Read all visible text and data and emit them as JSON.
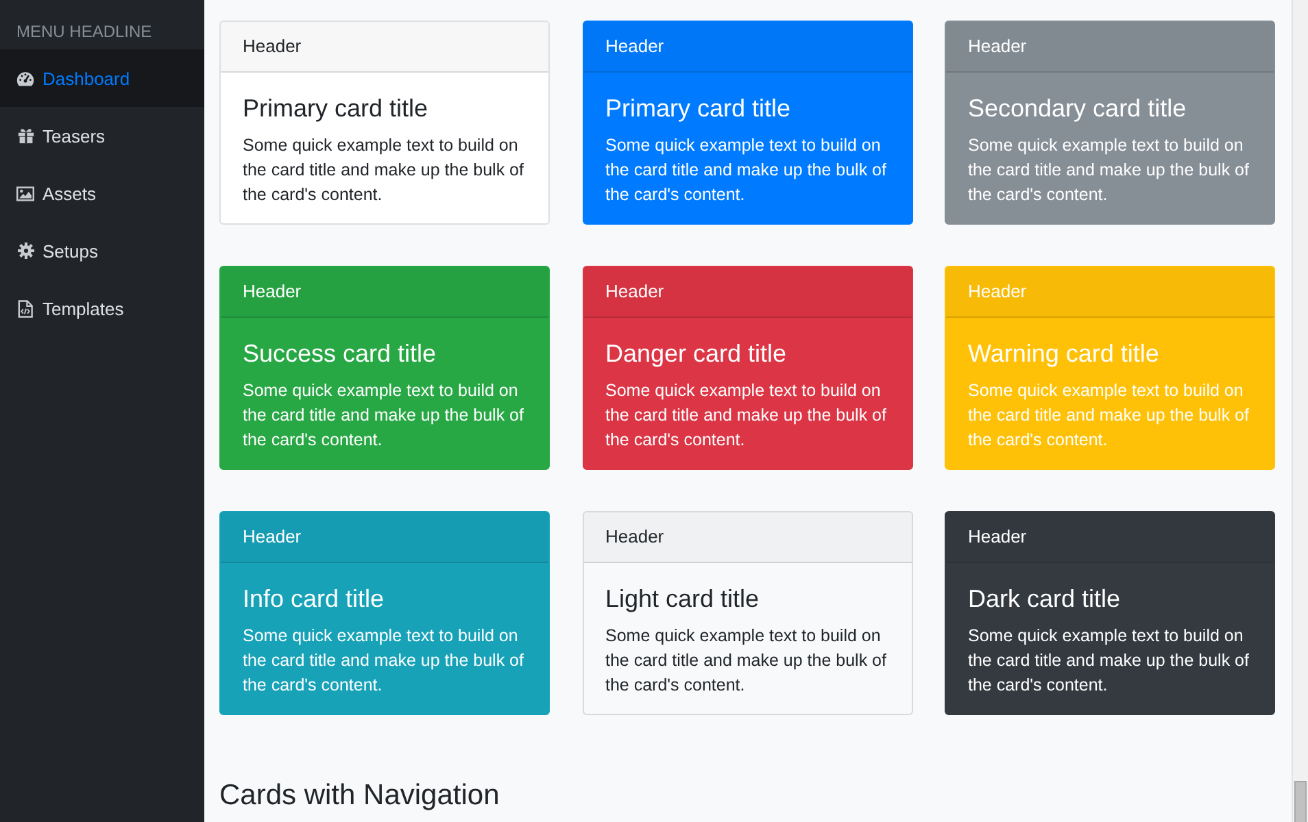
{
  "sidebar": {
    "headline": "MENU HEADLINE",
    "items": [
      {
        "label": "Dashboard",
        "selected": true
      },
      {
        "label": "Teasers",
        "selected": false
      },
      {
        "label": "Assets",
        "selected": false
      },
      {
        "label": "Setups",
        "selected": false
      },
      {
        "label": "Templates",
        "selected": false
      }
    ]
  },
  "cards": [
    {
      "kind": "plain",
      "header": "Header",
      "title": "Primary card title",
      "text": "Some quick example text to build on the card title and make up the bulk of the card's content."
    },
    {
      "kind": "primary",
      "header": "Header",
      "title": "Primary card title",
      "text": "Some quick example text to build on the card title and make up the bulk of the card's content."
    },
    {
      "kind": "secondary",
      "header": "Header",
      "title": "Secondary card title",
      "text": "Some quick example text to build on the card title and make up the bulk of the card's content."
    },
    {
      "kind": "success",
      "header": "Header",
      "title": "Success card title",
      "text": "Some quick example text to build on the card title and make up the bulk of the card's content."
    },
    {
      "kind": "danger",
      "header": "Header",
      "title": "Danger card title",
      "text": "Some quick example text to build on the card title and make up the bulk of the card's content."
    },
    {
      "kind": "warning",
      "header": "Header",
      "title": "Warning card title",
      "text": "Some quick example text to build on the card title and make up the bulk of the card's content."
    },
    {
      "kind": "info",
      "header": "Header",
      "title": "Info card title",
      "text": "Some quick example text to build on the card title and make up the bulk of the card's content."
    },
    {
      "kind": "light",
      "header": "Header",
      "title": "Light card title",
      "text": "Some quick example text to build on the card title and make up the bulk of the card's content."
    },
    {
      "kind": "dark",
      "header": "Header",
      "title": "Dark card title",
      "text": "Some quick example text to build on the card title and make up the bulk of the card's content."
    }
  ],
  "section_heading": "Cards with Navigation"
}
